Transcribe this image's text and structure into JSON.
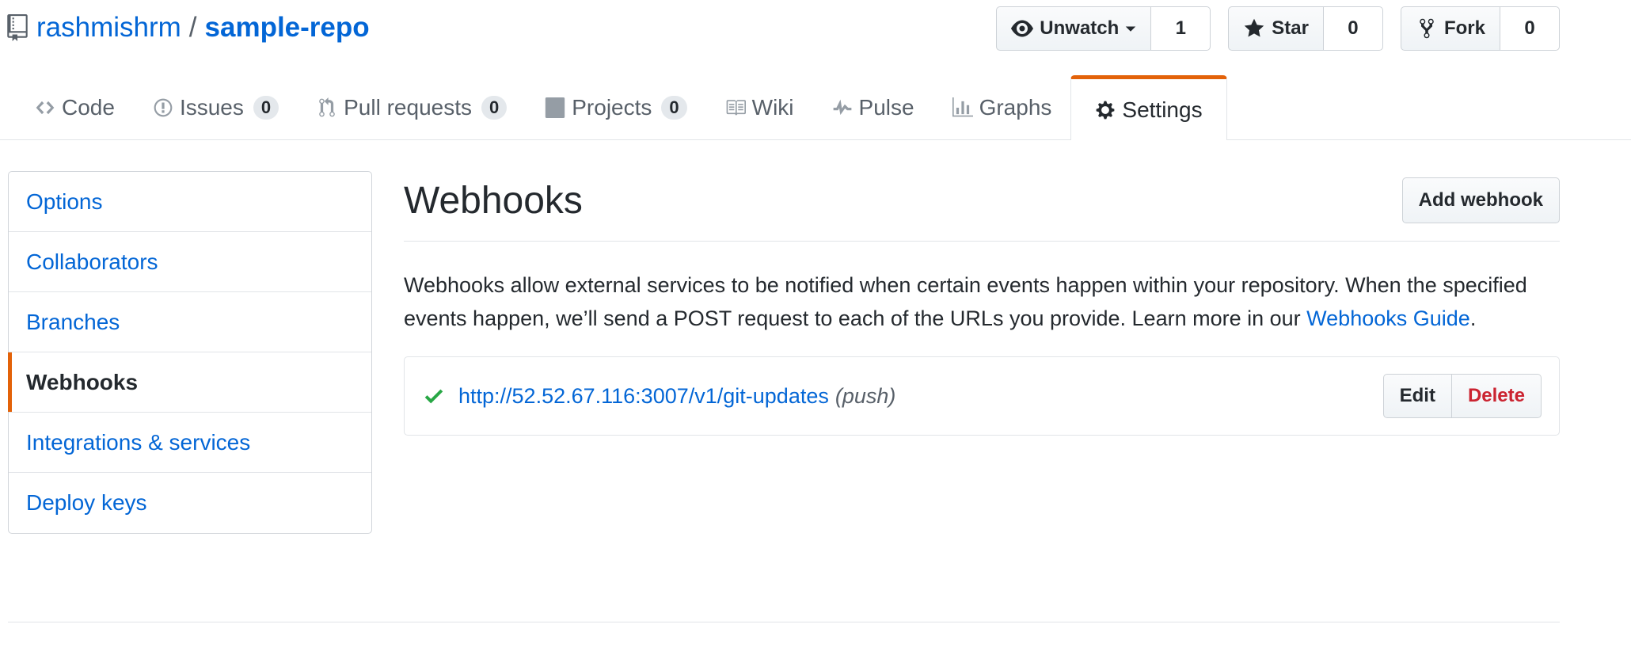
{
  "repo": {
    "owner": "rashmishrm",
    "separator": "/",
    "name": "sample-repo"
  },
  "actions": {
    "watch": {
      "label": "Unwatch",
      "count": "1",
      "icon": "eye-icon"
    },
    "star": {
      "label": "Star",
      "count": "0",
      "icon": "star-icon"
    },
    "fork": {
      "label": "Fork",
      "count": "0",
      "icon": "fork-icon"
    }
  },
  "nav": {
    "code": {
      "label": "Code",
      "icon": "code-icon"
    },
    "issues": {
      "label": "Issues",
      "count": "0",
      "icon": "issue-icon"
    },
    "pull_requests": {
      "label": "Pull requests",
      "count": "0",
      "icon": "git-pull-request-icon"
    },
    "projects": {
      "label": "Projects",
      "count": "0",
      "icon": "project-icon"
    },
    "wiki": {
      "label": "Wiki",
      "icon": "book-icon"
    },
    "pulse": {
      "label": "Pulse",
      "icon": "pulse-icon"
    },
    "graphs": {
      "label": "Graphs",
      "icon": "graph-icon"
    },
    "settings": {
      "label": "Settings",
      "icon": "gear-icon",
      "selected": true
    }
  },
  "sidebar": {
    "items": [
      {
        "label": "Options"
      },
      {
        "label": "Collaborators"
      },
      {
        "label": "Branches"
      },
      {
        "label": "Webhooks",
        "selected": true
      },
      {
        "label": "Integrations & services"
      },
      {
        "label": "Deploy keys"
      }
    ]
  },
  "main": {
    "heading": "Webhooks",
    "add_button": "Add webhook",
    "intro_text": "Webhooks allow external services to be notified when certain events happen within your repository. When the specified events happen, we’ll send a POST request to each of the URLs you provide. Learn more in our ",
    "intro_link": "Webhooks Guide",
    "intro_end": "."
  },
  "hooks": [
    {
      "status": "success",
      "url": "http://52.52.67.116:3007/v1/git-updates",
      "events": "(push)",
      "edit_label": "Edit",
      "delete_label": "Delete"
    }
  ],
  "colors": {
    "link": "#0366d6",
    "accent": "#e36209",
    "danger": "#cb2431",
    "success": "#28a745"
  }
}
